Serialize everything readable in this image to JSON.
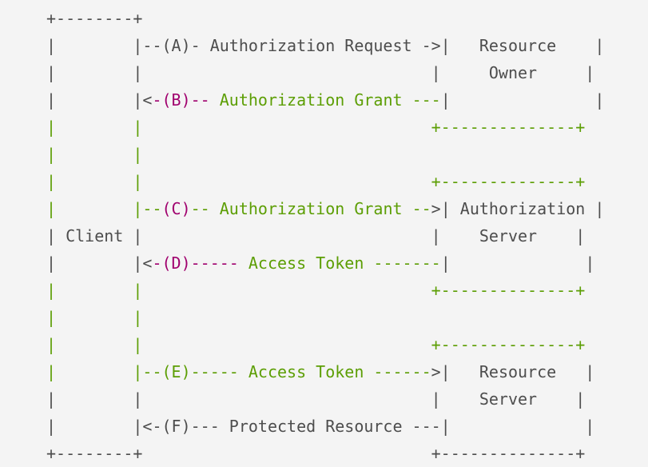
{
  "document": {
    "title": "OAuth 2.0 Protocol Flow",
    "kind": "ascii-sequence-diagram",
    "background_color": "#f4f4f4",
    "colors": {
      "gray": "#4d4d4d",
      "green": "#5c9e04",
      "magenta": "#a0006e"
    }
  },
  "participants": [
    {
      "id": "client",
      "label_line1": "Client",
      "label_line2": ""
    },
    {
      "id": "resource-owner",
      "label_line1": "Resource",
      "label_line2": "Owner"
    },
    {
      "id": "authorization-server",
      "label_line1": "Authorization",
      "label_line2": "Server"
    },
    {
      "id": "resource-server",
      "label_line1": "Resource",
      "label_line2": "Server"
    }
  ],
  "messages": [
    {
      "tag": "(A)",
      "label": "Authorization Request",
      "direction": "right",
      "from": "client",
      "to": "resource-owner"
    },
    {
      "tag": "(B)",
      "label": "Authorization Grant",
      "direction": "left",
      "from": "resource-owner",
      "to": "client"
    },
    {
      "tag": "(C)",
      "label": "Authorization Grant",
      "direction": "right",
      "from": "client",
      "to": "authorization-server"
    },
    {
      "tag": "(D)",
      "label": "Access Token",
      "direction": "left",
      "from": "authorization-server",
      "to": "client"
    },
    {
      "tag": "(E)",
      "label": "Access Token",
      "direction": "right",
      "from": "client",
      "to": "resource-server"
    },
    {
      "tag": "(F)",
      "label": "Protected Resource",
      "direction": "left",
      "from": "resource-server",
      "to": "client"
    }
  ],
  "lines": [
    {
      "index": 0,
      "name": "client-box-top-border",
      "segments": [
        {
          "text": "+--------+",
          "color": "gray"
        }
      ]
    },
    {
      "index": 1,
      "name": "message-a-row",
      "segments": [
        {
          "text": "|        |--(A)- Authorization Request ->|   Resource    |",
          "color": "gray"
        }
      ]
    },
    {
      "index": 2,
      "name": "resource-owner-label-row",
      "segments": [
        {
          "text": "|        |                              |     Owner     |",
          "color": "gray"
        }
      ]
    },
    {
      "index": 3,
      "name": "message-b-row",
      "segments": [
        {
          "text": "|        |<",
          "color": "gray"
        },
        {
          "text": "-(B)--",
          "color": "magenta"
        },
        {
          "text": " Authorization Grant ---",
          "color": "green"
        },
        {
          "text": "|",
          "color": "gray"
        },
        {
          "text": "               |",
          "color": "gray"
        }
      ]
    },
    {
      "index": 4,
      "name": "resource-owner-box-bottom-border-row",
      "segments": [
        {
          "text": "|        |                              +--------------+",
          "color": "green"
        }
      ]
    },
    {
      "index": 5,
      "name": "spacer-row-1",
      "segments": [
        {
          "text": "|        |",
          "color": "green"
        }
      ]
    },
    {
      "index": 6,
      "name": "authorization-server-box-top-border-row",
      "segments": [
        {
          "text": "|        |                              +--------------+",
          "color": "green"
        }
      ]
    },
    {
      "index": 7,
      "name": "message-c-row",
      "segments": [
        {
          "text": "|        |--",
          "color": "green"
        },
        {
          "text": "(C)",
          "color": "magenta"
        },
        {
          "text": "-- Authorization Grant --",
          "color": "green"
        },
        {
          "text": ">|",
          "color": "gray"
        },
        {
          "text": " Authorization |",
          "color": "gray"
        }
      ]
    },
    {
      "index": 8,
      "name": "client-label-row",
      "segments": [
        {
          "text": "| Client |                              |    Server    |",
          "color": "gray"
        }
      ]
    },
    {
      "index": 9,
      "name": "message-d-row",
      "segments": [
        {
          "text": "|        |<",
          "color": "gray"
        },
        {
          "text": "-(D)-----",
          "color": "magenta"
        },
        {
          "text": " Access Token -------",
          "color": "green"
        },
        {
          "text": "|",
          "color": "gray"
        },
        {
          "text": "              |",
          "color": "gray"
        }
      ]
    },
    {
      "index": 10,
      "name": "authorization-server-box-bottom-border-row",
      "segments": [
        {
          "text": "|        |                              +--------------+",
          "color": "green"
        }
      ]
    },
    {
      "index": 11,
      "name": "spacer-row-2",
      "segments": [
        {
          "text": "|        |",
          "color": "green"
        }
      ]
    },
    {
      "index": 12,
      "name": "resource-server-box-top-border-row",
      "segments": [
        {
          "text": "|        |                              +--------------+",
          "color": "green"
        }
      ]
    },
    {
      "index": 13,
      "name": "message-e-row",
      "segments": [
        {
          "text": "|        |--(E)----- Access Token ------",
          "color": "green"
        },
        {
          "text": ">|",
          "color": "gray"
        },
        {
          "text": "   Resource   |",
          "color": "gray"
        }
      ]
    },
    {
      "index": 14,
      "name": "resource-server-label-row",
      "segments": [
        {
          "text": "|        |                              |    Server    |",
          "color": "gray"
        }
      ]
    },
    {
      "index": 15,
      "name": "message-f-row",
      "segments": [
        {
          "text": "|        |<-(F)--- Protected Resource ---|              |",
          "color": "gray"
        }
      ]
    },
    {
      "index": 16,
      "name": "bottom-borders-row",
      "segments": [
        {
          "text": "+--------+                              +--------------+",
          "color": "gray"
        }
      ]
    }
  ]
}
